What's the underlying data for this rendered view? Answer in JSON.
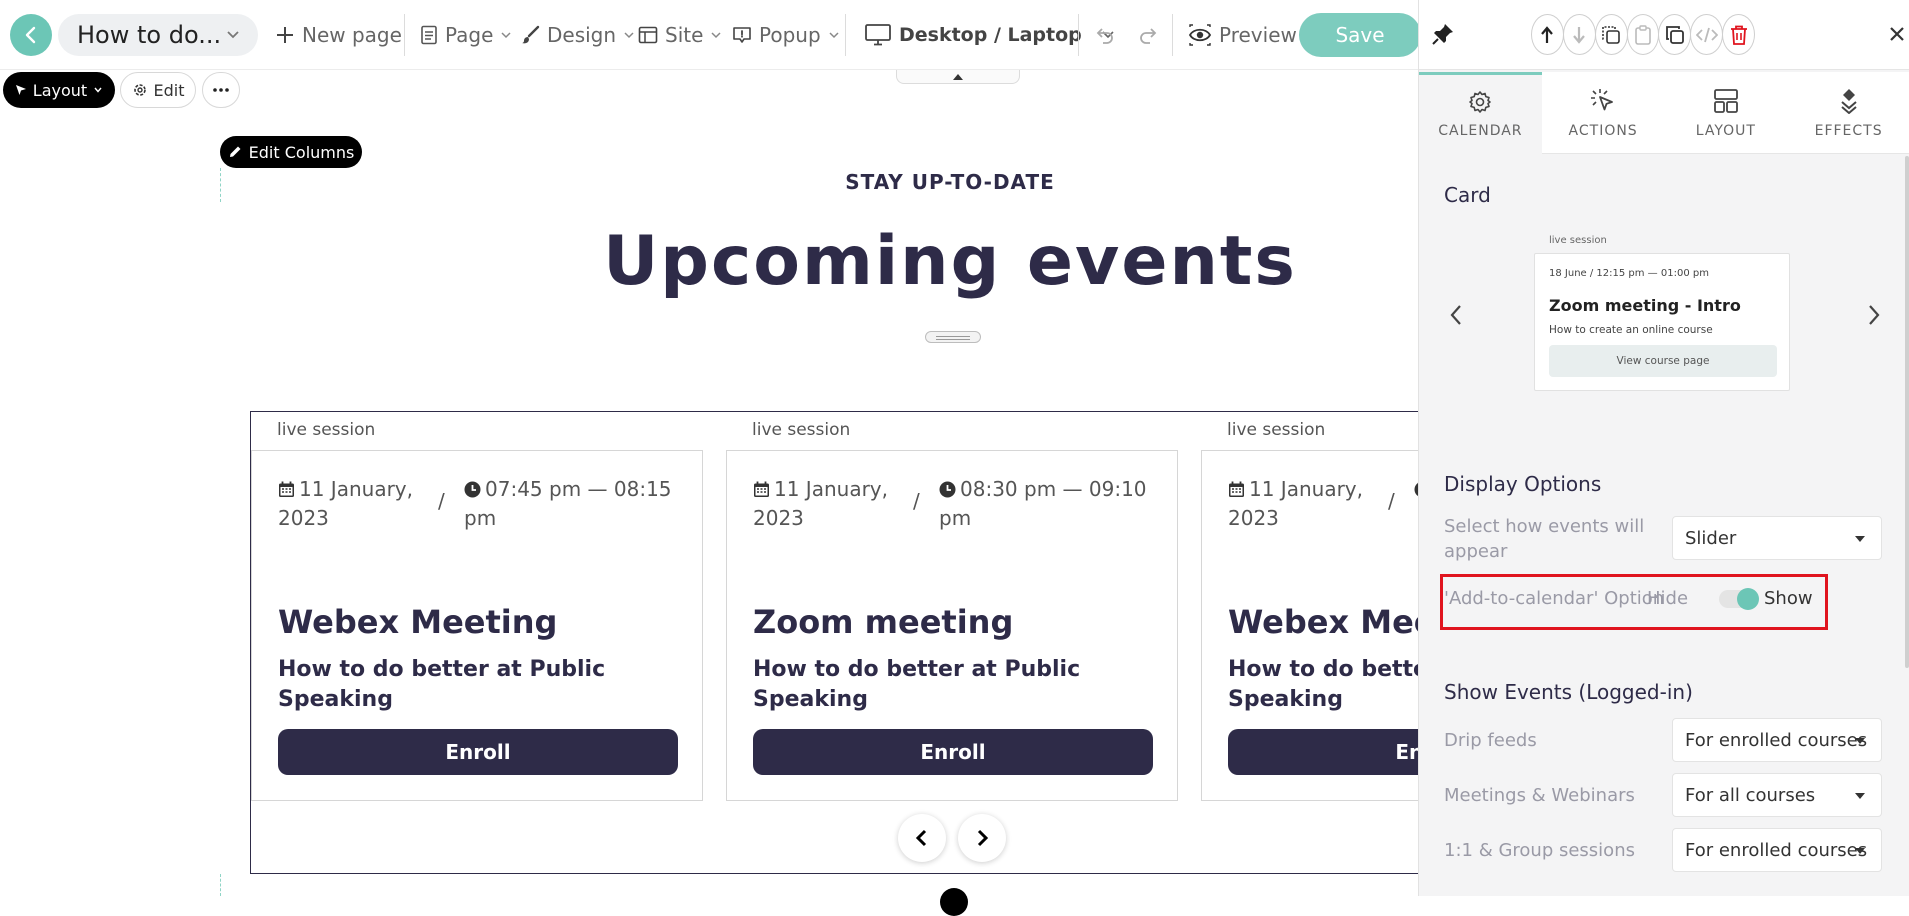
{
  "toolbar": {
    "page_name": "How to do...",
    "new_page": "New page",
    "page_menu": "Page",
    "design_menu": "Design",
    "site_menu": "Site",
    "popup_menu": "Popup",
    "device": "Desktop / Laptop",
    "preview": "Preview",
    "save": "Save"
  },
  "section_toolbar": {
    "layout": "Layout",
    "edit": "Edit",
    "edit_columns": "Edit Columns"
  },
  "section": {
    "kicker": "STAY UP-TO-DATE",
    "headline": "Upcoming events"
  },
  "cards": [
    {
      "type": "live session",
      "date": "11 January, 2023",
      "time": "07:45 pm — 08:15 pm",
      "title": "Webex Meeting",
      "subtitle": "How to do better at Public Speaking",
      "button": "Enroll"
    },
    {
      "type": "live session",
      "date": "11 January, 2023",
      "time": "08:30 pm — 09:10 pm",
      "title": "Zoom meeting",
      "subtitle": "How to do better at Public Speaking",
      "button": "Enroll"
    },
    {
      "type": "live session",
      "date": "11 January, 2023",
      "time": "",
      "title": "Webex Meeting",
      "subtitle": "How to do better at Public Speaking",
      "button": "Enroll"
    }
  ],
  "panel": {
    "tabs": [
      {
        "label": "CALENDAR",
        "icon": "gear-icon",
        "active": true
      },
      {
        "label": "ACTIONS",
        "icon": "cursor-click-icon",
        "active": false
      },
      {
        "label": "LAYOUT",
        "icon": "layout-icon",
        "active": false
      },
      {
        "label": "EFFECTS",
        "icon": "effects-icon",
        "active": false
      }
    ],
    "card_heading": "Card",
    "preview": {
      "type": "live session",
      "date": "18 June / ",
      "time": "12:15 pm — 01:00 pm",
      "title": "Zoom meeting - Intro",
      "subtitle": "How to create an online course",
      "button": "View course page"
    },
    "display_heading": "Display Options",
    "appear_label": "Select how events will appear",
    "appear_value": "Slider",
    "calendar_label": "'Add-to-calendar' Option",
    "toggle_off": "Hide",
    "toggle_on": "Show",
    "toggle_state": "Show",
    "events_heading": "Show Events (Logged-in)",
    "drip_label": "Drip feeds",
    "drip_value": "For enrolled courses",
    "meetings_label": "Meetings & Webinars",
    "meetings_value": "For all courses",
    "sessions_label": "1:1 & Group sessions",
    "sessions_value": "For enrolled courses"
  },
  "colors": {
    "accent": "#6cc6b6",
    "dark": "#2e2b48",
    "highlight": "#e0141e"
  }
}
